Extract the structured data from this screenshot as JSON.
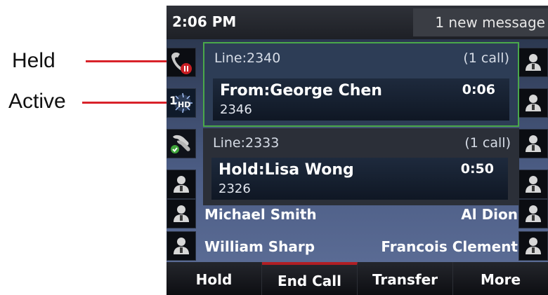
{
  "annotations": {
    "held": "Held",
    "active": "Active"
  },
  "status_bar": {
    "time": "2:06 PM",
    "new_message": "1 new message"
  },
  "calls": [
    {
      "line": "Line:2340",
      "count": "(1 call)",
      "party": "From:George Chen",
      "number": "2346",
      "duration": "0:06",
      "state": "active"
    },
    {
      "line": "Line:2333",
      "count": "(1 call)",
      "party": "Hold:Lisa Wong",
      "number": "2326",
      "duration": "0:50",
      "state": "held"
    }
  ],
  "line_key_badge": {
    "line_number": "1",
    "hd": "HD"
  },
  "contacts": [
    {
      "left": "Michael Smith",
      "right": "Al Dion"
    },
    {
      "left": "William Sharp",
      "right": "Francois Clement"
    }
  ],
  "softkeys": [
    "Hold",
    "End Call",
    "Transfer",
    "More"
  ],
  "colors": {
    "accent_red": "#b01e24",
    "active_border": "#4aa84a",
    "annotation_red": "#d8222a"
  }
}
